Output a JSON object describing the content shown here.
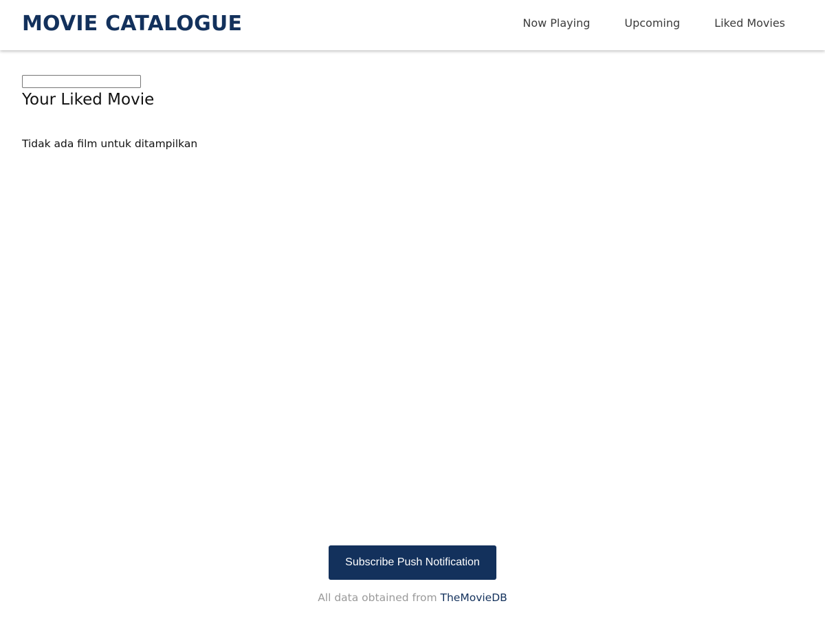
{
  "header": {
    "brand": "MOVIE CATALOGUE",
    "nav": [
      {
        "label": "Now Playing"
      },
      {
        "label": "Upcoming"
      },
      {
        "label": "Liked Movies"
      }
    ]
  },
  "main": {
    "search": {
      "value": "",
      "placeholder": ""
    },
    "title": "Your Liked Movie",
    "empty_message": "Tidak ada film untuk ditampilkan"
  },
  "footer": {
    "subscribe_label": "Subscribe Push Notification",
    "credit_prefix": "All data obtained from ",
    "credit_link": "TheMovieDB"
  },
  "colors": {
    "brand": "#13315c",
    "button_bg": "#13315c",
    "button_text": "#ffffff",
    "credit_text": "#9a9a9a"
  }
}
